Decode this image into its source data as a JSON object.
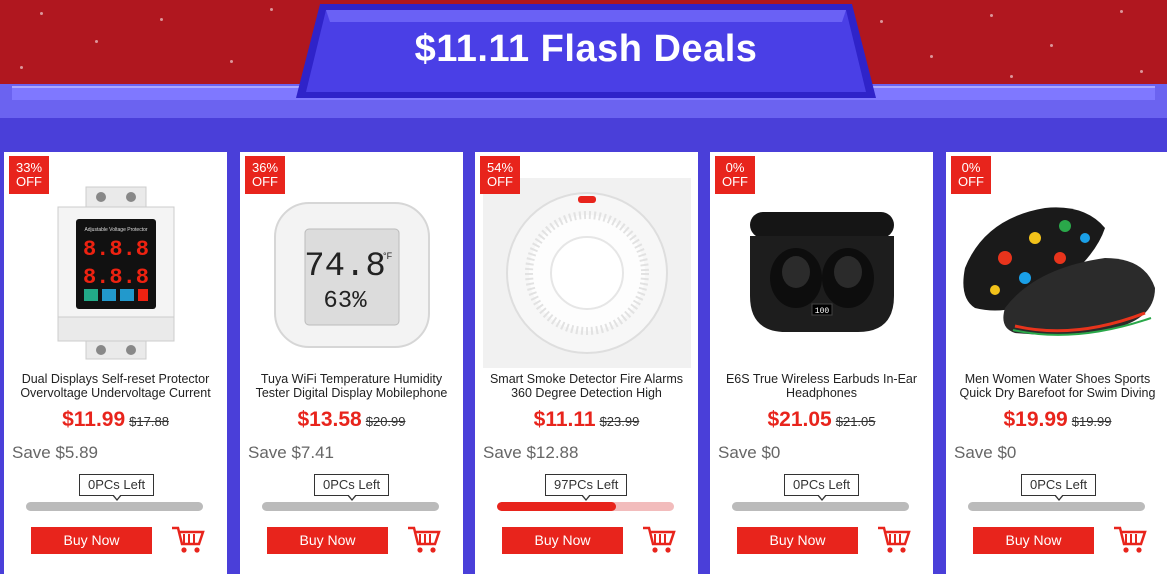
{
  "banner": {
    "title": "$11.11 Flash Deals"
  },
  "buy_label": "Buy Now",
  "colors": {
    "accent": "#e8241c",
    "background": "#4a3fd9",
    "banner_band": "#b0171f"
  },
  "products": [
    {
      "badge_pct": "33%",
      "badge_off": "OFF",
      "title": "Dual Displays Self-reset Protector Overvoltage Undervoltage Current",
      "price": "$11.99",
      "old_price": "$17.88",
      "save": "Save $5.89",
      "stock": "0PCs Left",
      "sold_fraction": 0,
      "image_icon": "din-rail-voltage-protector-icon"
    },
    {
      "badge_pct": "36%",
      "badge_off": "OFF",
      "title": "Tuya WiFi Temperature Humidity Tester Digital Display Mobilephone",
      "price": "$13.58",
      "old_price": "$20.99",
      "save": "Save $7.41",
      "stock": "0PCs Left",
      "sold_fraction": 0,
      "image_icon": "wifi-thermometer-hygrometer-icon",
      "display": {
        "temp": "74.8",
        "unit": "°F",
        "humidity": "63%"
      }
    },
    {
      "badge_pct": "54%",
      "badge_off": "OFF",
      "title": "Smart Smoke Detector Fire Alarms 360 Degree Detection High",
      "price": "$11.11",
      "old_price": "$23.99",
      "save": "Save $12.88",
      "stock": "97PCs Left",
      "sold_fraction": 0.67,
      "image_icon": "smoke-detector-icon"
    },
    {
      "badge_pct": "0%",
      "badge_off": "OFF",
      "title": "E6S True Wireless Earbuds In-Ear Headphones",
      "price": "$21.05",
      "old_price": "$21.05",
      "save": "Save $0",
      "stock": "0PCs Left",
      "sold_fraction": 0,
      "image_icon": "wireless-earbuds-icon",
      "display": {
        "level": "100"
      }
    },
    {
      "badge_pct": "0%",
      "badge_off": "OFF",
      "title": "Men Women Water Shoes Sports Quick Dry Barefoot for Swim Diving",
      "price": "$19.99",
      "old_price": "$19.99",
      "save": "Save $0",
      "stock": "0PCs Left",
      "sold_fraction": 0,
      "image_icon": "water-shoes-icon"
    }
  ]
}
